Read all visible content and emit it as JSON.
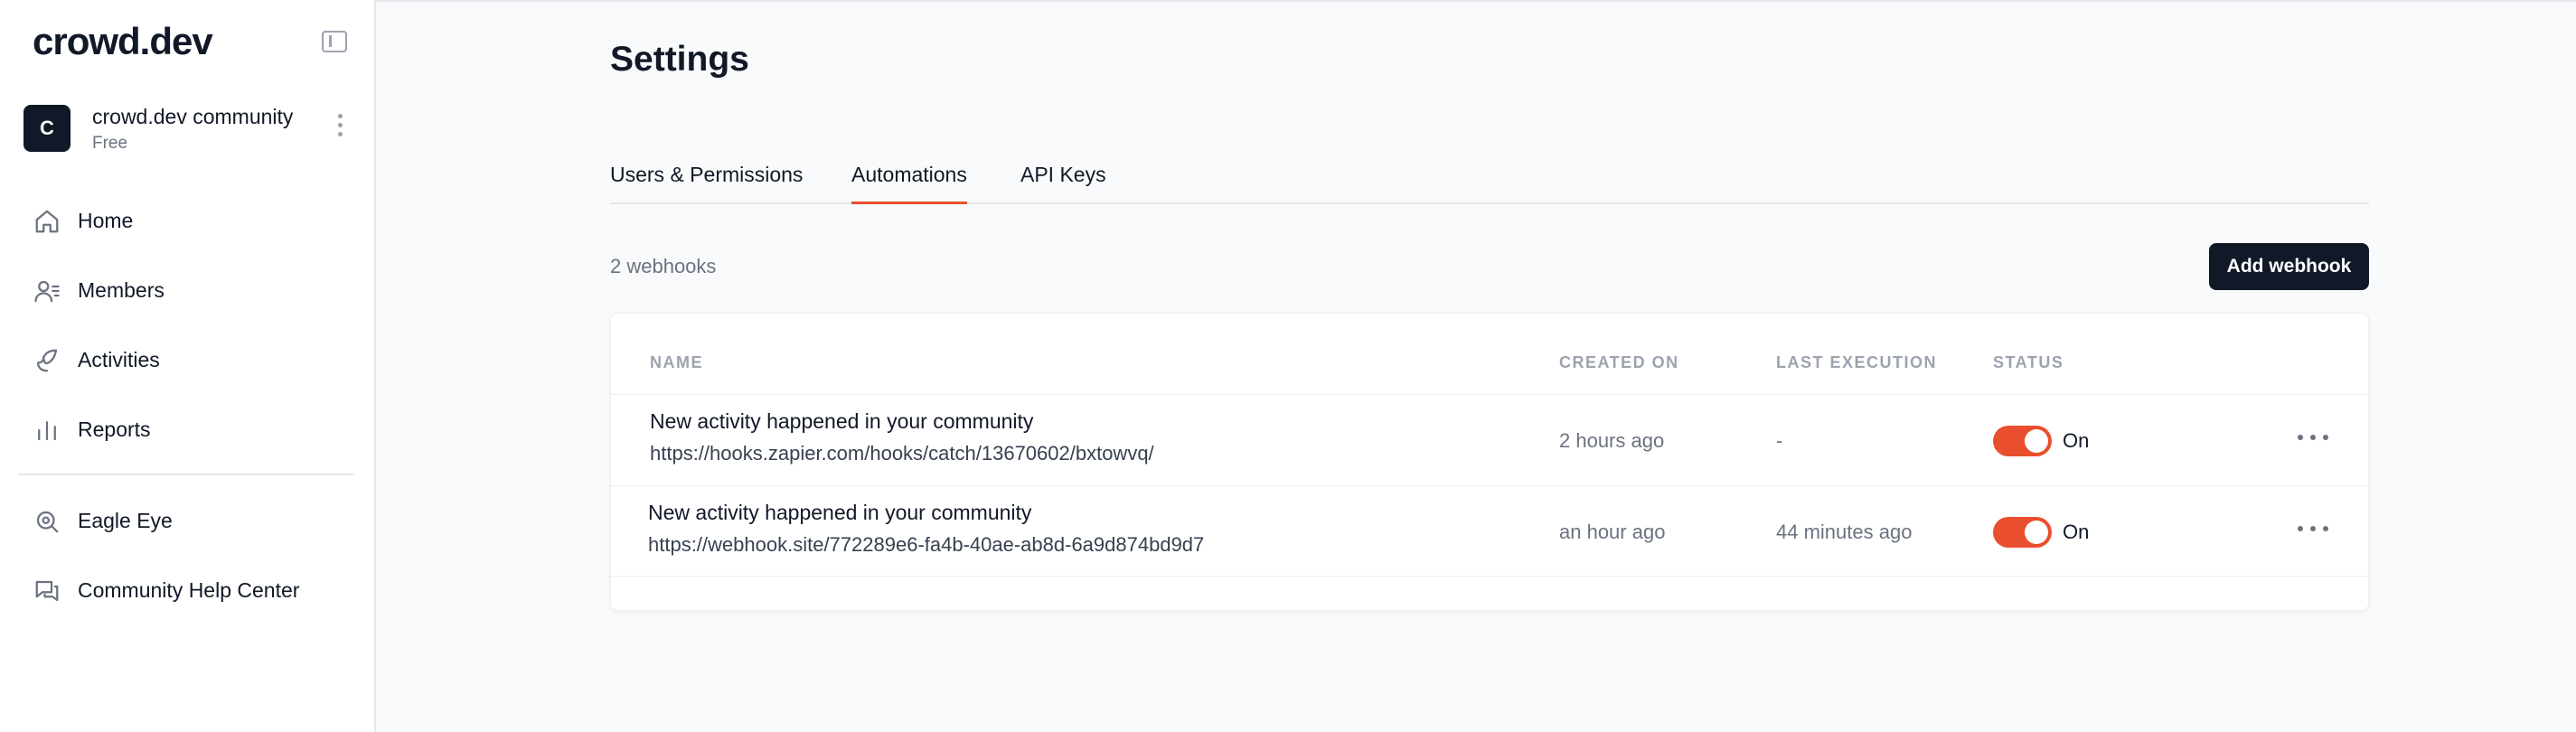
{
  "app": {
    "logo": "crowd.dev"
  },
  "workspace": {
    "avatar_letter": "C",
    "name": "crowd.dev community",
    "plan": "Free"
  },
  "nav": {
    "items": [
      {
        "label": "Home",
        "icon": "home-icon"
      },
      {
        "label": "Members",
        "icon": "members-icon"
      },
      {
        "label": "Activities",
        "icon": "activities-icon"
      },
      {
        "label": "Reports",
        "icon": "reports-icon"
      }
    ],
    "secondary": [
      {
        "label": "Eagle Eye",
        "icon": "eagle-eye-icon"
      },
      {
        "label": "Community Help Center",
        "icon": "chat-icon"
      }
    ]
  },
  "page": {
    "title": "Settings"
  },
  "tabs": [
    {
      "label": "Users & Permissions",
      "active": false
    },
    {
      "label": "Automations",
      "active": true
    },
    {
      "label": "API Keys",
      "active": false
    }
  ],
  "webhooks": {
    "count_label": "2 webhooks",
    "add_button": "Add webhook",
    "columns": {
      "name": "NAME",
      "created_on": "CREATED ON",
      "last_execution": "LAST EXECUTION",
      "status": "STATUS"
    },
    "rows": [
      {
        "name": "New activity happened in your community",
        "url": "https://hooks.zapier.com/hooks/catch/13670602/bxtowvq/",
        "created_on": "2 hours ago",
        "last_execution": "-",
        "status": "On"
      },
      {
        "name": "New activity happened in your community",
        "url": "https://webhook.site/772289e6-fa4b-40ae-ab8d-6a9d874bd9d7",
        "created_on": "an hour ago",
        "last_execution": "44 minutes ago",
        "status": "On"
      }
    ]
  },
  "colors": {
    "accent": "#e94f2e",
    "dark": "#111827",
    "muted": "#6b7280"
  }
}
